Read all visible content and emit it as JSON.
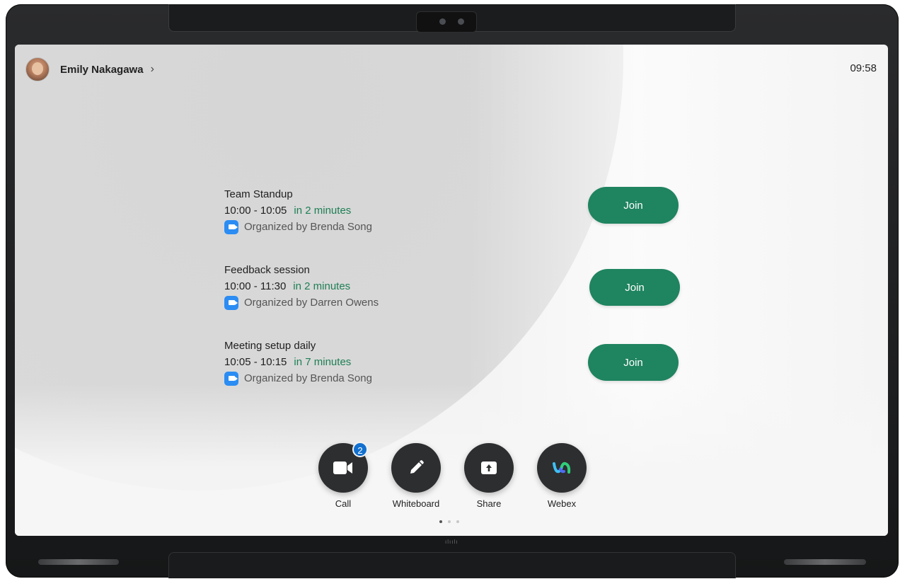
{
  "header": {
    "user_name": "Emily Nakagawa",
    "chevron": "›",
    "clock": "09:58"
  },
  "meetings": [
    {
      "title": "Team Standup",
      "time": "10:00 - 10:05",
      "soon": "in 2 minutes",
      "organizer": "Organized by Brenda Song",
      "join_label": "Join"
    },
    {
      "title": "Feedback session",
      "time": "10:00 - 11:30",
      "soon": "in 2 minutes",
      "organizer": "Organized by Darren Owens",
      "join_label": "Join"
    },
    {
      "title": "Meeting setup daily",
      "time": "10:05 - 10:15",
      "soon": "in 7 minutes",
      "organizer": "Organized by Brenda Song",
      "join_label": "Join"
    }
  ],
  "dock": [
    {
      "label": "Call",
      "icon": "video-camera-icon",
      "badge": "2"
    },
    {
      "label": "Whiteboard",
      "icon": "pencil-icon"
    },
    {
      "label": "Share",
      "icon": "share-screen-icon"
    },
    {
      "label": "Webex",
      "icon": "webex-logo-icon"
    }
  ],
  "pager": {
    "pages": 3,
    "active": 1
  },
  "colors": {
    "join_button": "#1f8460",
    "soon_text": "#1e7f55",
    "badge": "#1170cf",
    "dock_button": "#2d2e30"
  }
}
